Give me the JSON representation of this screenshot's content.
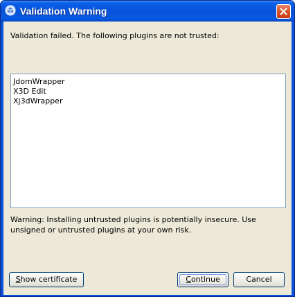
{
  "window": {
    "title": "Validation Warning",
    "icon": "java-cup-icon",
    "close_icon": "close-icon"
  },
  "dialog": {
    "message": "Validation failed. The following plugins are not trusted:",
    "plugins": [
      "JdomWrapper",
      "X3D Edit",
      "Xj3dWrapper"
    ],
    "warning": "Warning: Installing untrusted plugins is potentially insecure. Use unsigned or untrusted plugins at your own risk."
  },
  "buttons": {
    "show_certificate": {
      "mnemonic": "S",
      "rest": "how certificate"
    },
    "continue": {
      "mnemonic": "C",
      "rest": "ontinue"
    },
    "cancel": "Cancel"
  },
  "colors": {
    "titlebar": "#0754d9",
    "client_bg": "#ece9d8",
    "close_button": "#d9562d"
  }
}
